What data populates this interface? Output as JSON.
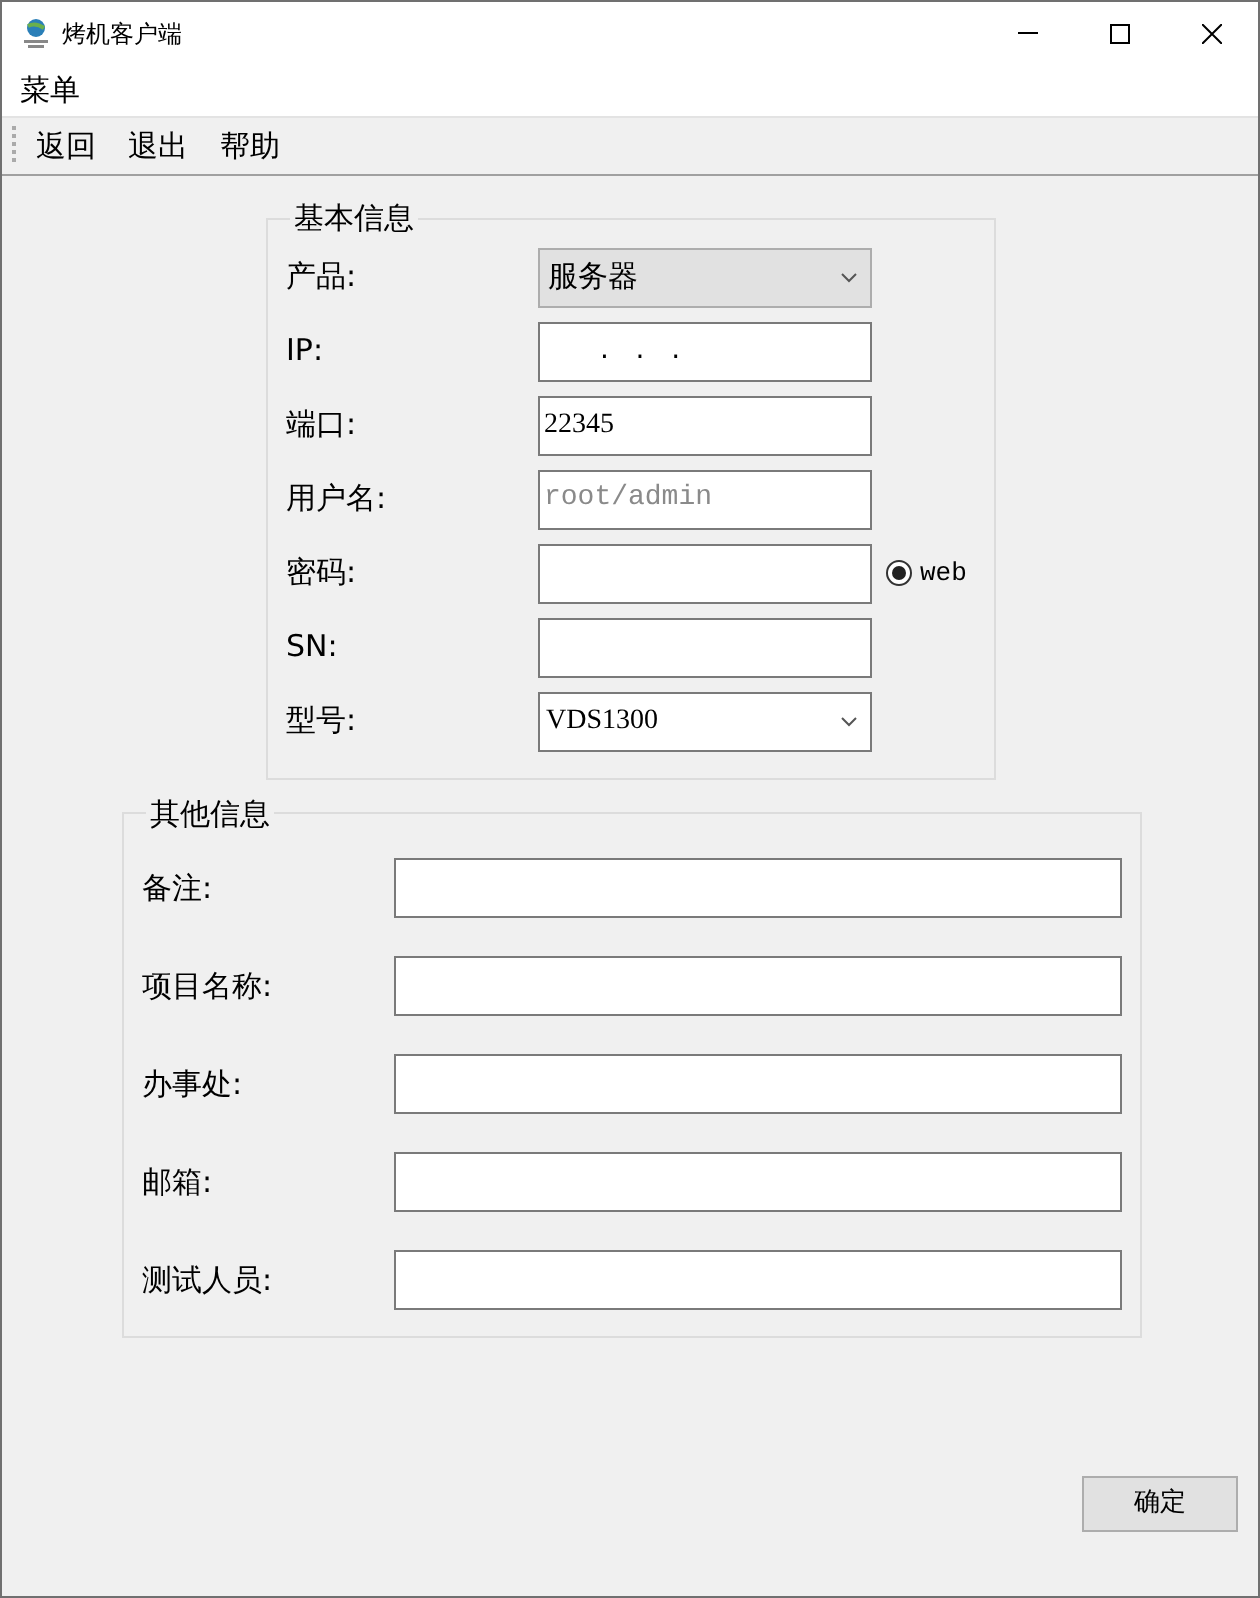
{
  "window": {
    "title": "烤机客户端"
  },
  "menu_bar": [
    "菜单"
  ],
  "toolbar": [
    "返回",
    "退出",
    "帮助"
  ],
  "basic_info": {
    "title": "基本信息",
    "fields": [
      {
        "label": "产品:",
        "kind": "select",
        "value": "服务器"
      },
      {
        "label": "IP:",
        "kind": "ip",
        "value": ".   .   ."
      },
      {
        "label": "端口:",
        "kind": "input",
        "value": "22345"
      },
      {
        "label": "用户名:",
        "kind": "input",
        "placeholder": "root/admin"
      },
      {
        "label": "密码:",
        "kind": "input",
        "radio": {
          "label": "web",
          "selected": true
        }
      },
      {
        "label": "SN:",
        "kind": "input"
      },
      {
        "label": "型号:",
        "kind": "combo",
        "value": "VDS1300"
      }
    ]
  },
  "other_info": {
    "title": "其他信息",
    "fields": [
      {
        "label": "备注:"
      },
      {
        "label": "项目名称:"
      },
      {
        "label": "办事处:"
      },
      {
        "label": "邮箱:"
      },
      {
        "label": "测试人员:"
      }
    ]
  },
  "confirm_button": "确定"
}
